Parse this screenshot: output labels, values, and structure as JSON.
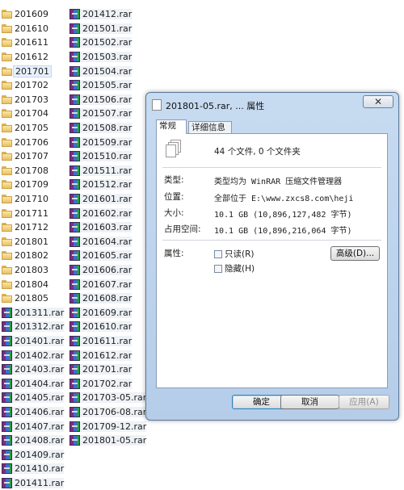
{
  "explorer": {
    "column1": [
      {
        "label": "201609",
        "type": "folder"
      },
      {
        "label": "201610",
        "type": "folder"
      },
      {
        "label": "201611",
        "type": "folder"
      },
      {
        "label": "201612",
        "type": "folder"
      },
      {
        "label": "201701",
        "type": "folder",
        "selected": true
      },
      {
        "label": "201702",
        "type": "folder"
      },
      {
        "label": "201703",
        "type": "folder"
      },
      {
        "label": "201704",
        "type": "folder"
      },
      {
        "label": "201705",
        "type": "folder"
      },
      {
        "label": "201706",
        "type": "folder"
      },
      {
        "label": "201707",
        "type": "folder"
      },
      {
        "label": "201708",
        "type": "folder"
      },
      {
        "label": "201709",
        "type": "folder"
      },
      {
        "label": "201710",
        "type": "folder"
      },
      {
        "label": "201711",
        "type": "folder"
      },
      {
        "label": "201712",
        "type": "folder"
      },
      {
        "label": "201801",
        "type": "folder"
      },
      {
        "label": "201802",
        "type": "folder"
      },
      {
        "label": "201803",
        "type": "folder"
      },
      {
        "label": "201804",
        "type": "folder"
      },
      {
        "label": "201805",
        "type": "folder"
      },
      {
        "label": "201311.rar",
        "type": "rar"
      },
      {
        "label": "201312.rar",
        "type": "rar"
      },
      {
        "label": "201401.rar",
        "type": "rar"
      },
      {
        "label": "201402.rar",
        "type": "rar"
      },
      {
        "label": "201403.rar",
        "type": "rar"
      },
      {
        "label": "201404.rar",
        "type": "rar"
      },
      {
        "label": "201405.rar",
        "type": "rar"
      },
      {
        "label": "201406.rar",
        "type": "rar"
      },
      {
        "label": "201407.rar",
        "type": "rar"
      },
      {
        "label": "201408.rar",
        "type": "rar"
      },
      {
        "label": "201409.rar",
        "type": "rar"
      },
      {
        "label": "201410.rar",
        "type": "rar"
      },
      {
        "label": "201411.rar",
        "type": "rar"
      }
    ],
    "column2": [
      {
        "label": "201412.rar",
        "type": "rar"
      },
      {
        "label": "201501.rar",
        "type": "rar"
      },
      {
        "label": "201502.rar",
        "type": "rar"
      },
      {
        "label": "201503.rar",
        "type": "rar"
      },
      {
        "label": "201504.rar",
        "type": "rar"
      },
      {
        "label": "201505.rar",
        "type": "rar"
      },
      {
        "label": "201506.rar",
        "type": "rar"
      },
      {
        "label": "201507.rar",
        "type": "rar"
      },
      {
        "label": "201508.rar",
        "type": "rar"
      },
      {
        "label": "201509.rar",
        "type": "rar"
      },
      {
        "label": "201510.rar",
        "type": "rar"
      },
      {
        "label": "201511.rar",
        "type": "rar"
      },
      {
        "label": "201512.rar",
        "type": "rar"
      },
      {
        "label": "201601.rar",
        "type": "rar"
      },
      {
        "label": "201602.rar",
        "type": "rar"
      },
      {
        "label": "201603.rar",
        "type": "rar"
      },
      {
        "label": "201604.rar",
        "type": "rar"
      },
      {
        "label": "201605.rar",
        "type": "rar"
      },
      {
        "label": "201606.rar",
        "type": "rar"
      },
      {
        "label": "201607.rar",
        "type": "rar"
      },
      {
        "label": "201608.rar",
        "type": "rar"
      },
      {
        "label": "201609.rar",
        "type": "rar"
      },
      {
        "label": "201610.rar",
        "type": "rar"
      },
      {
        "label": "201611.rar",
        "type": "rar"
      },
      {
        "label": "201612.rar",
        "type": "rar"
      },
      {
        "label": "201701.rar",
        "type": "rar"
      },
      {
        "label": "201702.rar",
        "type": "rar"
      },
      {
        "label": "201703-05.rar",
        "type": "rar"
      },
      {
        "label": "201706-08.rar",
        "type": "rar"
      },
      {
        "label": "201709-12.rar",
        "type": "rar"
      },
      {
        "label": "201801-05.rar",
        "type": "rar"
      }
    ]
  },
  "dialog": {
    "title": "201801-05.rar, ... 属性",
    "close_label": "✕",
    "tabs": {
      "general": "常规",
      "details": "详细信息"
    },
    "summary": "44 个文件, 0 个文件夹",
    "type_label": "类型:",
    "type_value": "类型均为 WinRAR 压缩文件管理器",
    "location_label": "位置:",
    "location_value": "全部位于 E:\\www.zxcs8.com\\heji",
    "size_label": "大小:",
    "size_value": "10.1 GB (10,896,127,482 字节)",
    "disk_label": "占用空间:",
    "disk_value": "10.1 GB (10,896,216,064 字节)",
    "attr_label": "属性:",
    "readonly_label": "只读(R)",
    "hidden_label": "隐藏(H)",
    "advanced_label": "高级(D)...",
    "ok_label": "确定",
    "cancel_label": "取消",
    "apply_label": "应用(A)"
  },
  "colors": {
    "selection": "#e8f1fb",
    "dialog_frame": "#b5cde9"
  }
}
